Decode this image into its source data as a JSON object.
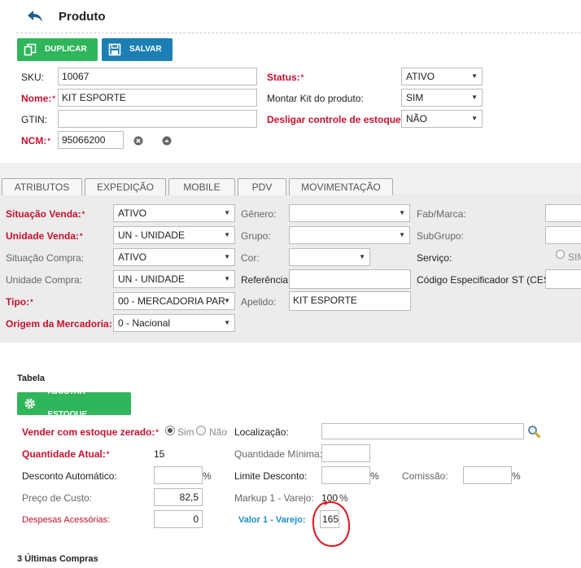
{
  "header": {
    "title": "Produto"
  },
  "toolbar": {
    "duplicate_label": "DUPLICAR",
    "save_label": "SALVAR"
  },
  "form": {
    "sku_label": "SKU:",
    "sku_value": "10067",
    "name_label": "Nome:",
    "name_value": "KIT ESPORTE",
    "gtin_label": "GTIN:",
    "gtin_value": "",
    "ncm_label": "NCM:",
    "ncm_value": "95066200",
    "status_label": "Status:",
    "status_value": "ATIVO",
    "kit_label": "Montar Kit do produto:",
    "kit_value": "SIM",
    "stock_control_label": "Desligar controle de estoque:",
    "stock_control_value": "NÃO"
  },
  "tabs": [
    "ATRIBUTOS",
    "EXPEDIÇÃO",
    "MOBILE",
    "PDV",
    "MOVIMENTAÇÃO"
  ],
  "attributes": {
    "sale_status_label": "Situação Venda:",
    "sale_status_value": "ATIVO",
    "sale_unit_label": "Unidade Venda:",
    "sale_unit_value": "UN - UNIDADE",
    "purchase_status_label": "Situação Compra:",
    "purchase_status_value": "ATIVO",
    "purchase_unit_label": "Unidade Compra:",
    "purchase_unit_value": "UN - UNIDADE",
    "type_label": "Tipo:",
    "type_value": "00 - MERCADORIA PAR",
    "origin_label": "Origem da Mercadoria:",
    "origin_value": "0 - Nacional",
    "gender_label": "Gênero:",
    "gender_value": "",
    "group_label": "Grupo:",
    "group_value": "",
    "color_label": "Cor:",
    "color_value": "",
    "reference_label": "Referência:",
    "reference_value": "",
    "nickname_label": "Apelido:",
    "nickname_value": "KIT ESPORTE",
    "brand_label": "Fab/Marca:",
    "brand_value": "",
    "subgroup_label": "SubGrupo:",
    "subgroup_value": "",
    "service_label": "Serviço:",
    "service_option": "SIM",
    "cest_label": "Código Especificador ST (CEST):",
    "cest_value": ""
  },
  "table": {
    "section_title": "Tabela",
    "adjust_stock_label": "AJUSTAR ESTOQUE",
    "sell_zero_label": "Vender com estoque zerado:",
    "yes_label": "Sim",
    "no_label": "Não",
    "location_label": "Localização:",
    "location_value": "",
    "current_qty_label": "Quantidade Atual:",
    "current_qty_value": "15",
    "min_qty_label": "Quantidade Mínima:",
    "min_qty_value": "",
    "auto_discount_label": "Desconto Automático:",
    "auto_discount_value": "",
    "discount_limit_label": "Limite Desconto:",
    "discount_limit_value": "",
    "commission_label": "Comissão:",
    "commission_value": "",
    "cost_label": "Preço de Custo:",
    "cost_value": "82,5",
    "markup_label": "Markup 1 - Varejo:",
    "markup_value": "100",
    "extra_costs_label": "Despesas Acessórias:",
    "extra_costs_value": "0",
    "retail_value_label": "Valor 1 - Varejo:",
    "retail_value_value": "165",
    "percent": "%"
  },
  "footer": {
    "last_purchases_title": "3 Últimas Compras"
  },
  "colors": {
    "green": "#2fb55a",
    "blue": "#1b7fb4",
    "red": "#c8102e",
    "annotation": "#e0141e",
    "link_blue": "#1a8fd0"
  }
}
